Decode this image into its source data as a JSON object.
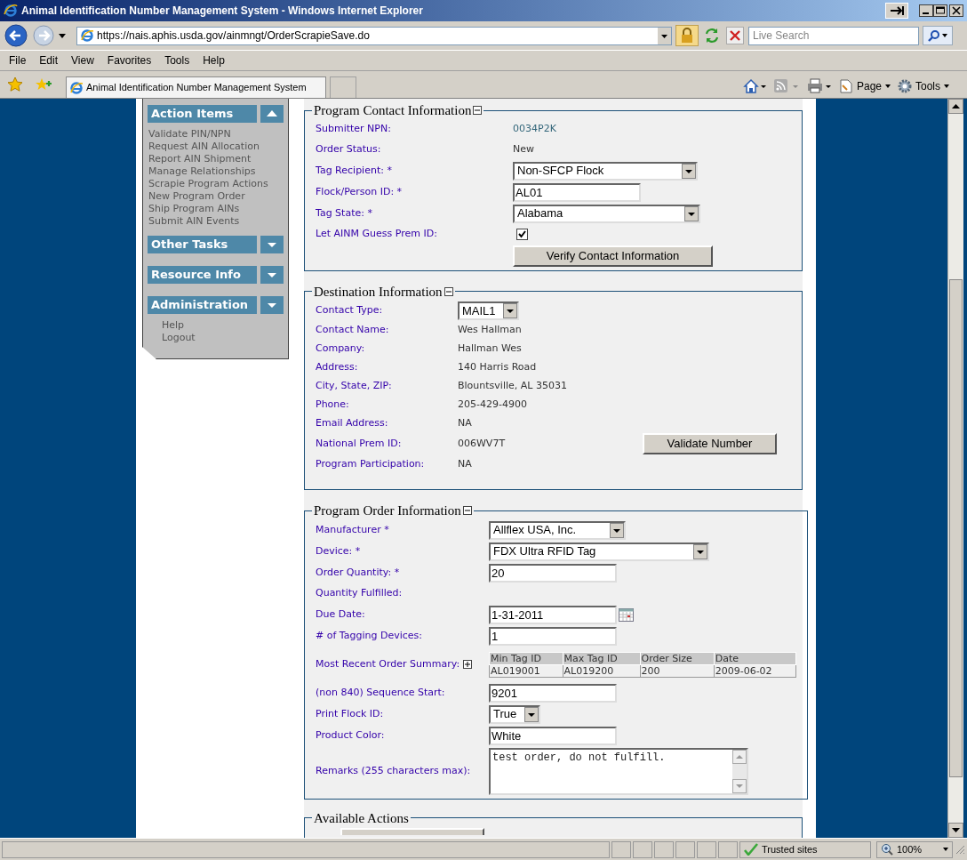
{
  "window": {
    "title": "Animal Identification Number Management System - Windows Internet Explorer"
  },
  "address_bar": {
    "url": "https://nais.aphis.usda.gov/ainmngt/OrderScrapieSave.do"
  },
  "search": {
    "placeholder": "Live Search"
  },
  "menu": [
    "File",
    "Edit",
    "View",
    "Favorites",
    "Tools",
    "Help"
  ],
  "tabs": [
    {
      "label": "Animal Identification Number Management System",
      "selected": true
    }
  ],
  "command_bar": [
    "Page",
    "Tools"
  ],
  "sidebar": {
    "sections": [
      {
        "title": "Action Items",
        "expanded": true,
        "items": [
          "Validate PIN/NPN",
          "Request AIN Allocation",
          "Report AIN Shipment",
          "Manage Relationships",
          "Scrapie Program Actions",
          "New Program Order",
          "Ship Program AINs",
          "Submit AIN Events"
        ]
      },
      {
        "title": "Other Tasks",
        "expanded": false
      },
      {
        "title": "Resource Info",
        "expanded": false
      },
      {
        "title": "Administration",
        "expanded": false,
        "items": [
          "Help",
          "Logout"
        ]
      }
    ]
  },
  "contact": {
    "title": "Program Contact Information",
    "rows": [
      {
        "kind": "text",
        "label": "Submitter NPN:",
        "value": "0034P2K"
      },
      {
        "kind": "text",
        "label": "Order Status:",
        "value": "New"
      },
      {
        "kind": "select",
        "label": "Tag Recipient: *",
        "value": "Non-SFCP Flock"
      },
      {
        "kind": "input",
        "label": "Flock/Person ID: *",
        "value": "AL01"
      },
      {
        "kind": "select",
        "label": "Tag State: *",
        "value": "Alabama"
      },
      {
        "kind": "checkbox",
        "label": "Let AINM Guess Prem ID:",
        "checked": true
      }
    ],
    "button": "Verify Contact Information"
  },
  "destination": {
    "title": "Destination Information",
    "rows": [
      {
        "kind": "select",
        "label": "Contact Type:",
        "value": "MAIL1"
      },
      {
        "kind": "text",
        "label": "Contact Name:",
        "value": "Wes Hallman"
      },
      {
        "kind": "text",
        "label": "Company:",
        "value": "Hallman Wes"
      },
      {
        "kind": "text",
        "label": "Address:",
        "value": "140 Harris Road"
      },
      {
        "kind": "text",
        "label": "City, State, ZIP:",
        "value": "Blountsville, AL 35031"
      },
      {
        "kind": "text",
        "label": "Phone:",
        "value": "205-429-4900"
      },
      {
        "kind": "text",
        "label": "Email Address:",
        "value": "NA"
      },
      {
        "kind": "text",
        "label": "National Prem ID:",
        "value": "006WV7T",
        "button": "Validate Number"
      },
      {
        "kind": "text",
        "label": "Program Participation:",
        "value": "NA"
      }
    ]
  },
  "order": {
    "title": "Program Order Information",
    "rows": [
      {
        "kind": "select",
        "label": "Manufacturer *",
        "value": "Allflex USA, Inc."
      },
      {
        "kind": "select",
        "label": "Device: *",
        "value": "FDX Ultra RFID Tag"
      },
      {
        "kind": "input",
        "label": "Order Quantity: *",
        "value": "20"
      },
      {
        "kind": "text",
        "label": "Quantity Fulfilled:"
      },
      {
        "kind": "date",
        "label": "Due Date:",
        "value": "1-31-2011"
      },
      {
        "kind": "input",
        "label": "# of Tagging Devices:",
        "value": "1"
      },
      {
        "kind": "table",
        "label": "Most Recent Order Summary:",
        "columns": [
          "Min Tag ID",
          "Max Tag ID",
          "Order Size",
          "Date"
        ],
        "rows": [
          [
            "AL019001",
            "AL019200",
            "200",
            "2009-06-02"
          ]
        ]
      },
      {
        "kind": "input",
        "label": "(non 840) Sequence Start:",
        "value": "9201"
      },
      {
        "kind": "select",
        "label": "Print Flock ID:",
        "value": "True"
      },
      {
        "kind": "input",
        "label": "Product Color:",
        "value": "White"
      },
      {
        "kind": "textarea",
        "label": "Remarks (255 characters max):",
        "value": "test order, do not fulfill."
      }
    ]
  },
  "actions": {
    "title": "Available Actions"
  },
  "status_bar": {
    "zone": "Trusted sites",
    "zoom": "100%"
  }
}
